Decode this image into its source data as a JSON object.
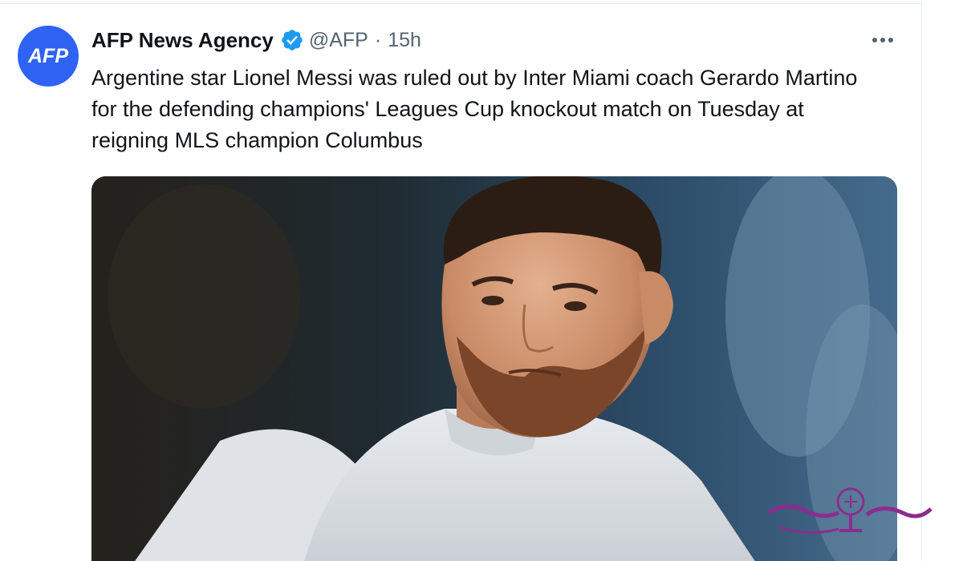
{
  "tweet": {
    "avatar_text": "AFP",
    "author_name": "AFP News Agency",
    "handle": "@AFP",
    "separator": "·",
    "timestamp": "15h",
    "text": "Argentine star Lionel Messi was ruled out by Inter Miami coach Gerardo Martino for the defending champions' Leagues Cup knockout match on Tuesday at reigning MLS champion Columbus"
  },
  "colors": {
    "avatar_bg": "#2f63f4",
    "verified": "#1d9bf0",
    "text": "#0f1419",
    "secondary_text": "#536471",
    "watermark": "#8b2d8e"
  },
  "icons": {
    "verified": "verified-badge-icon",
    "more": "more-options-icon"
  }
}
